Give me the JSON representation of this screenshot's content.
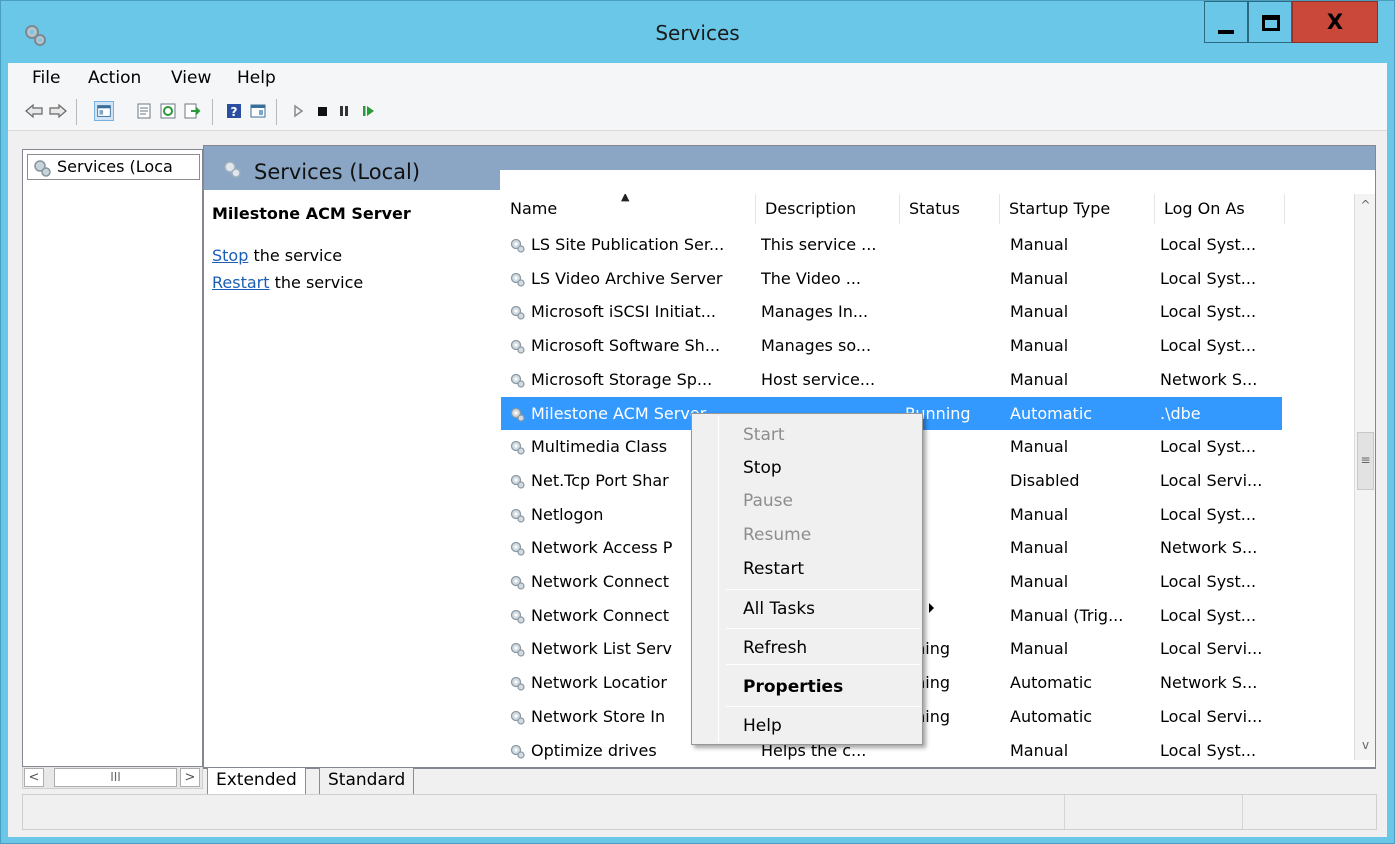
{
  "window": {
    "title": "Services",
    "close_glyph": "X"
  },
  "menubar": {
    "items": [
      "File",
      "Action",
      "View",
      "Help"
    ]
  },
  "tree": {
    "item_label": "Services (Loca",
    "hscroll_thumb": "III",
    "left_arrow": "<",
    "right_arrow": ">"
  },
  "pane": {
    "header_title": "Services (Local)",
    "selected_service": "Milestone ACM Server",
    "stop_link": "Stop",
    "stop_suffix": " the service",
    "restart_link": "Restart",
    "restart_suffix": " the service"
  },
  "columns": [
    "Name",
    "Description",
    "Status",
    "Startup Type",
    "Log On As"
  ],
  "rows": [
    {
      "name": "LS Site Publication Ser...",
      "description": "This service ...",
      "status": "",
      "startup": "Manual",
      "logon": "Local Syst..."
    },
    {
      "name": "LS Video Archive Server",
      "description": "The Video ...",
      "status": "",
      "startup": "Manual",
      "logon": "Local Syst..."
    },
    {
      "name": "Microsoft iSCSI Initiat...",
      "description": "Manages In...",
      "status": "",
      "startup": "Manual",
      "logon": "Local Syst..."
    },
    {
      "name": "Microsoft Software Sh...",
      "description": "Manages so...",
      "status": "",
      "startup": "Manual",
      "logon": "Local Syst..."
    },
    {
      "name": "Microsoft Storage Sp...",
      "description": "Host service...",
      "status": "",
      "startup": "Manual",
      "logon": "Network S..."
    },
    {
      "name": "Milestone ACM Server",
      "description": "",
      "status": "Running",
      "startup": "Automatic",
      "logon": ".\\dbe"
    },
    {
      "name": "Multimedia Class",
      "description": "",
      "status": "",
      "startup": "Manual",
      "logon": "Local Syst..."
    },
    {
      "name": "Net.Tcp Port Shar",
      "description": "",
      "status": "",
      "startup": "Disabled",
      "logon": "Local Servi..."
    },
    {
      "name": "Netlogon",
      "description": "",
      "status": "",
      "startup": "Manual",
      "logon": "Local Syst..."
    },
    {
      "name": "Network Access P",
      "description": "",
      "status": "",
      "startup": "Manual",
      "logon": "Network S..."
    },
    {
      "name": "Network Connect",
      "description": "",
      "status": "",
      "startup": "Manual",
      "logon": "Local Syst..."
    },
    {
      "name": "Network Connect",
      "description": "",
      "status": "",
      "startup": "Manual (Trig...",
      "logon": "Local Syst..."
    },
    {
      "name": "Network List Serv",
      "description": "",
      "status": "nning",
      "startup": "Manual",
      "logon": "Local Servi..."
    },
    {
      "name": "Network Locatior",
      "description": "",
      "status": "nning",
      "startup": "Automatic",
      "logon": "Network S..."
    },
    {
      "name": "Network Store In",
      "description": "",
      "status": "nning",
      "startup": "Automatic",
      "logon": "Local Servi..."
    },
    {
      "name": "Optimize drives",
      "description": "Helps the c...",
      "status": "",
      "startup": "Manual",
      "logon": "Local Syst..."
    }
  ],
  "context_menu": {
    "items": [
      {
        "label": "Start",
        "disabled": true
      },
      {
        "label": "Stop",
        "disabled": false
      },
      {
        "label": "Pause",
        "disabled": true
      },
      {
        "label": "Resume",
        "disabled": true
      },
      {
        "label": "Restart",
        "disabled": false
      },
      {
        "label": "All Tasks",
        "disabled": false,
        "submenu": true
      },
      {
        "label": "Refresh",
        "disabled": false
      },
      {
        "label": "Properties",
        "disabled": false,
        "bold": true
      },
      {
        "label": "Help",
        "disabled": false
      }
    ]
  },
  "tabs": [
    "Extended",
    "Standard"
  ],
  "colors": {
    "titlebar": "#6ac7e8",
    "close_button": "#c9483a",
    "selection": "#3399ff",
    "header_band": "#8aa6c4",
    "link": "#1a5fb4"
  }
}
